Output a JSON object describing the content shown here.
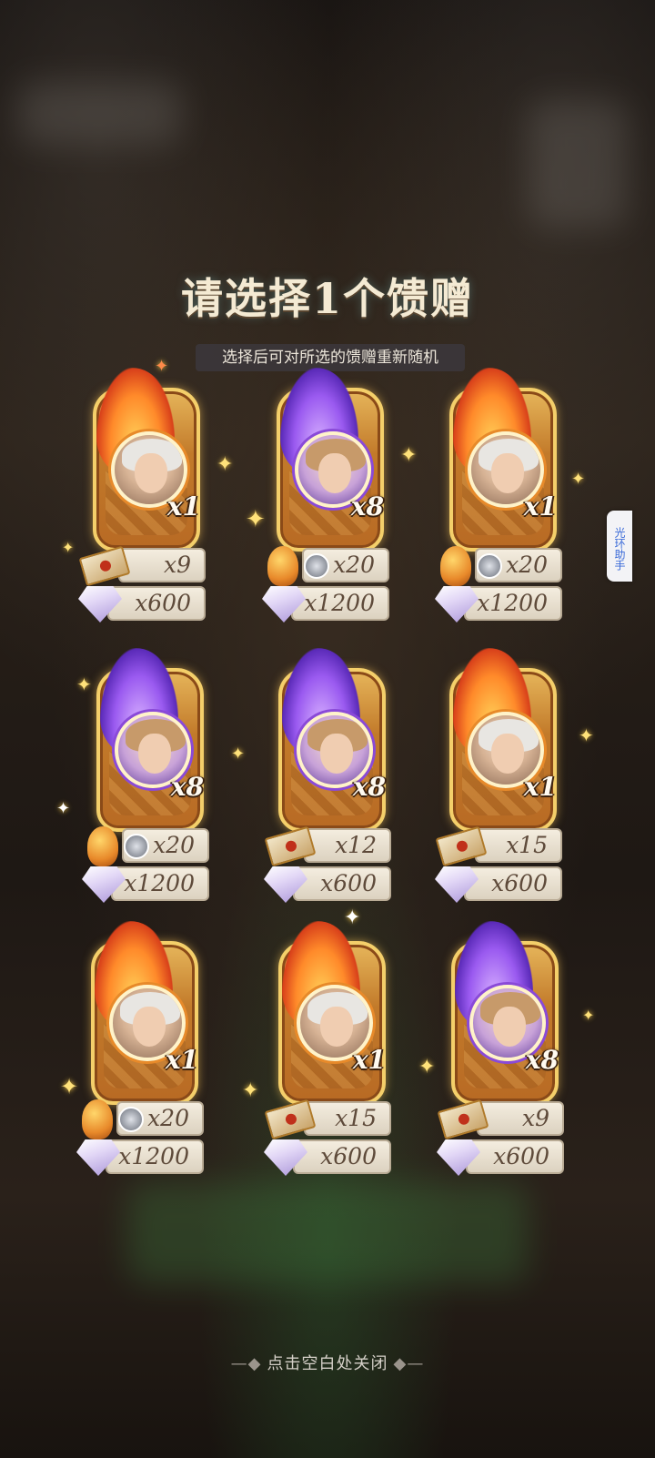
{
  "title": "请选择1个馈赠",
  "subtitle": "选择后可对所选的馈赠重新随机",
  "side_tab": "光环助手",
  "close_hint": "点击空白处关闭",
  "close_hint_decor": "—◆",
  "close_hint_decor_r": "◆—",
  "cards": [
    {
      "frame": "fire",
      "count": "x1",
      "row1": "x9",
      "row1_icon": "letter-icon",
      "row2": "x600"
    },
    {
      "frame": "purple",
      "count": "x8",
      "row1": "x20",
      "row1_icon": "key-icon",
      "row2": "x1200"
    },
    {
      "frame": "fire",
      "count": "x1",
      "row1": "x20",
      "row1_icon": "key-icon",
      "row2": "x1200"
    },
    {
      "frame": "purple",
      "count": "x8",
      "row1": "x20",
      "row1_icon": "key-icon",
      "row2": "x1200"
    },
    {
      "frame": "purple",
      "count": "x8",
      "row1": "x12",
      "row1_icon": "letter-icon",
      "row2": "x600"
    },
    {
      "frame": "fire",
      "count": "x1",
      "row1": "x15",
      "row1_icon": "letter-icon",
      "row2": "x600"
    },
    {
      "frame": "fire",
      "count": "x1",
      "row1": "x20",
      "row1_icon": "key-icon",
      "row2": "x1200"
    },
    {
      "frame": "fire",
      "count": "x1",
      "row1": "x15",
      "row1_icon": "letter-icon",
      "row2": "x600"
    },
    {
      "frame": "purple",
      "count": "x8",
      "row1": "x9",
      "row1_icon": "letter-icon",
      "row2": "x600"
    }
  ],
  "colors": {
    "gold": "#f4cf6a",
    "fire": "#e78a2a",
    "purple": "#8a4ad8",
    "text_dark": "#5e4a3a"
  }
}
